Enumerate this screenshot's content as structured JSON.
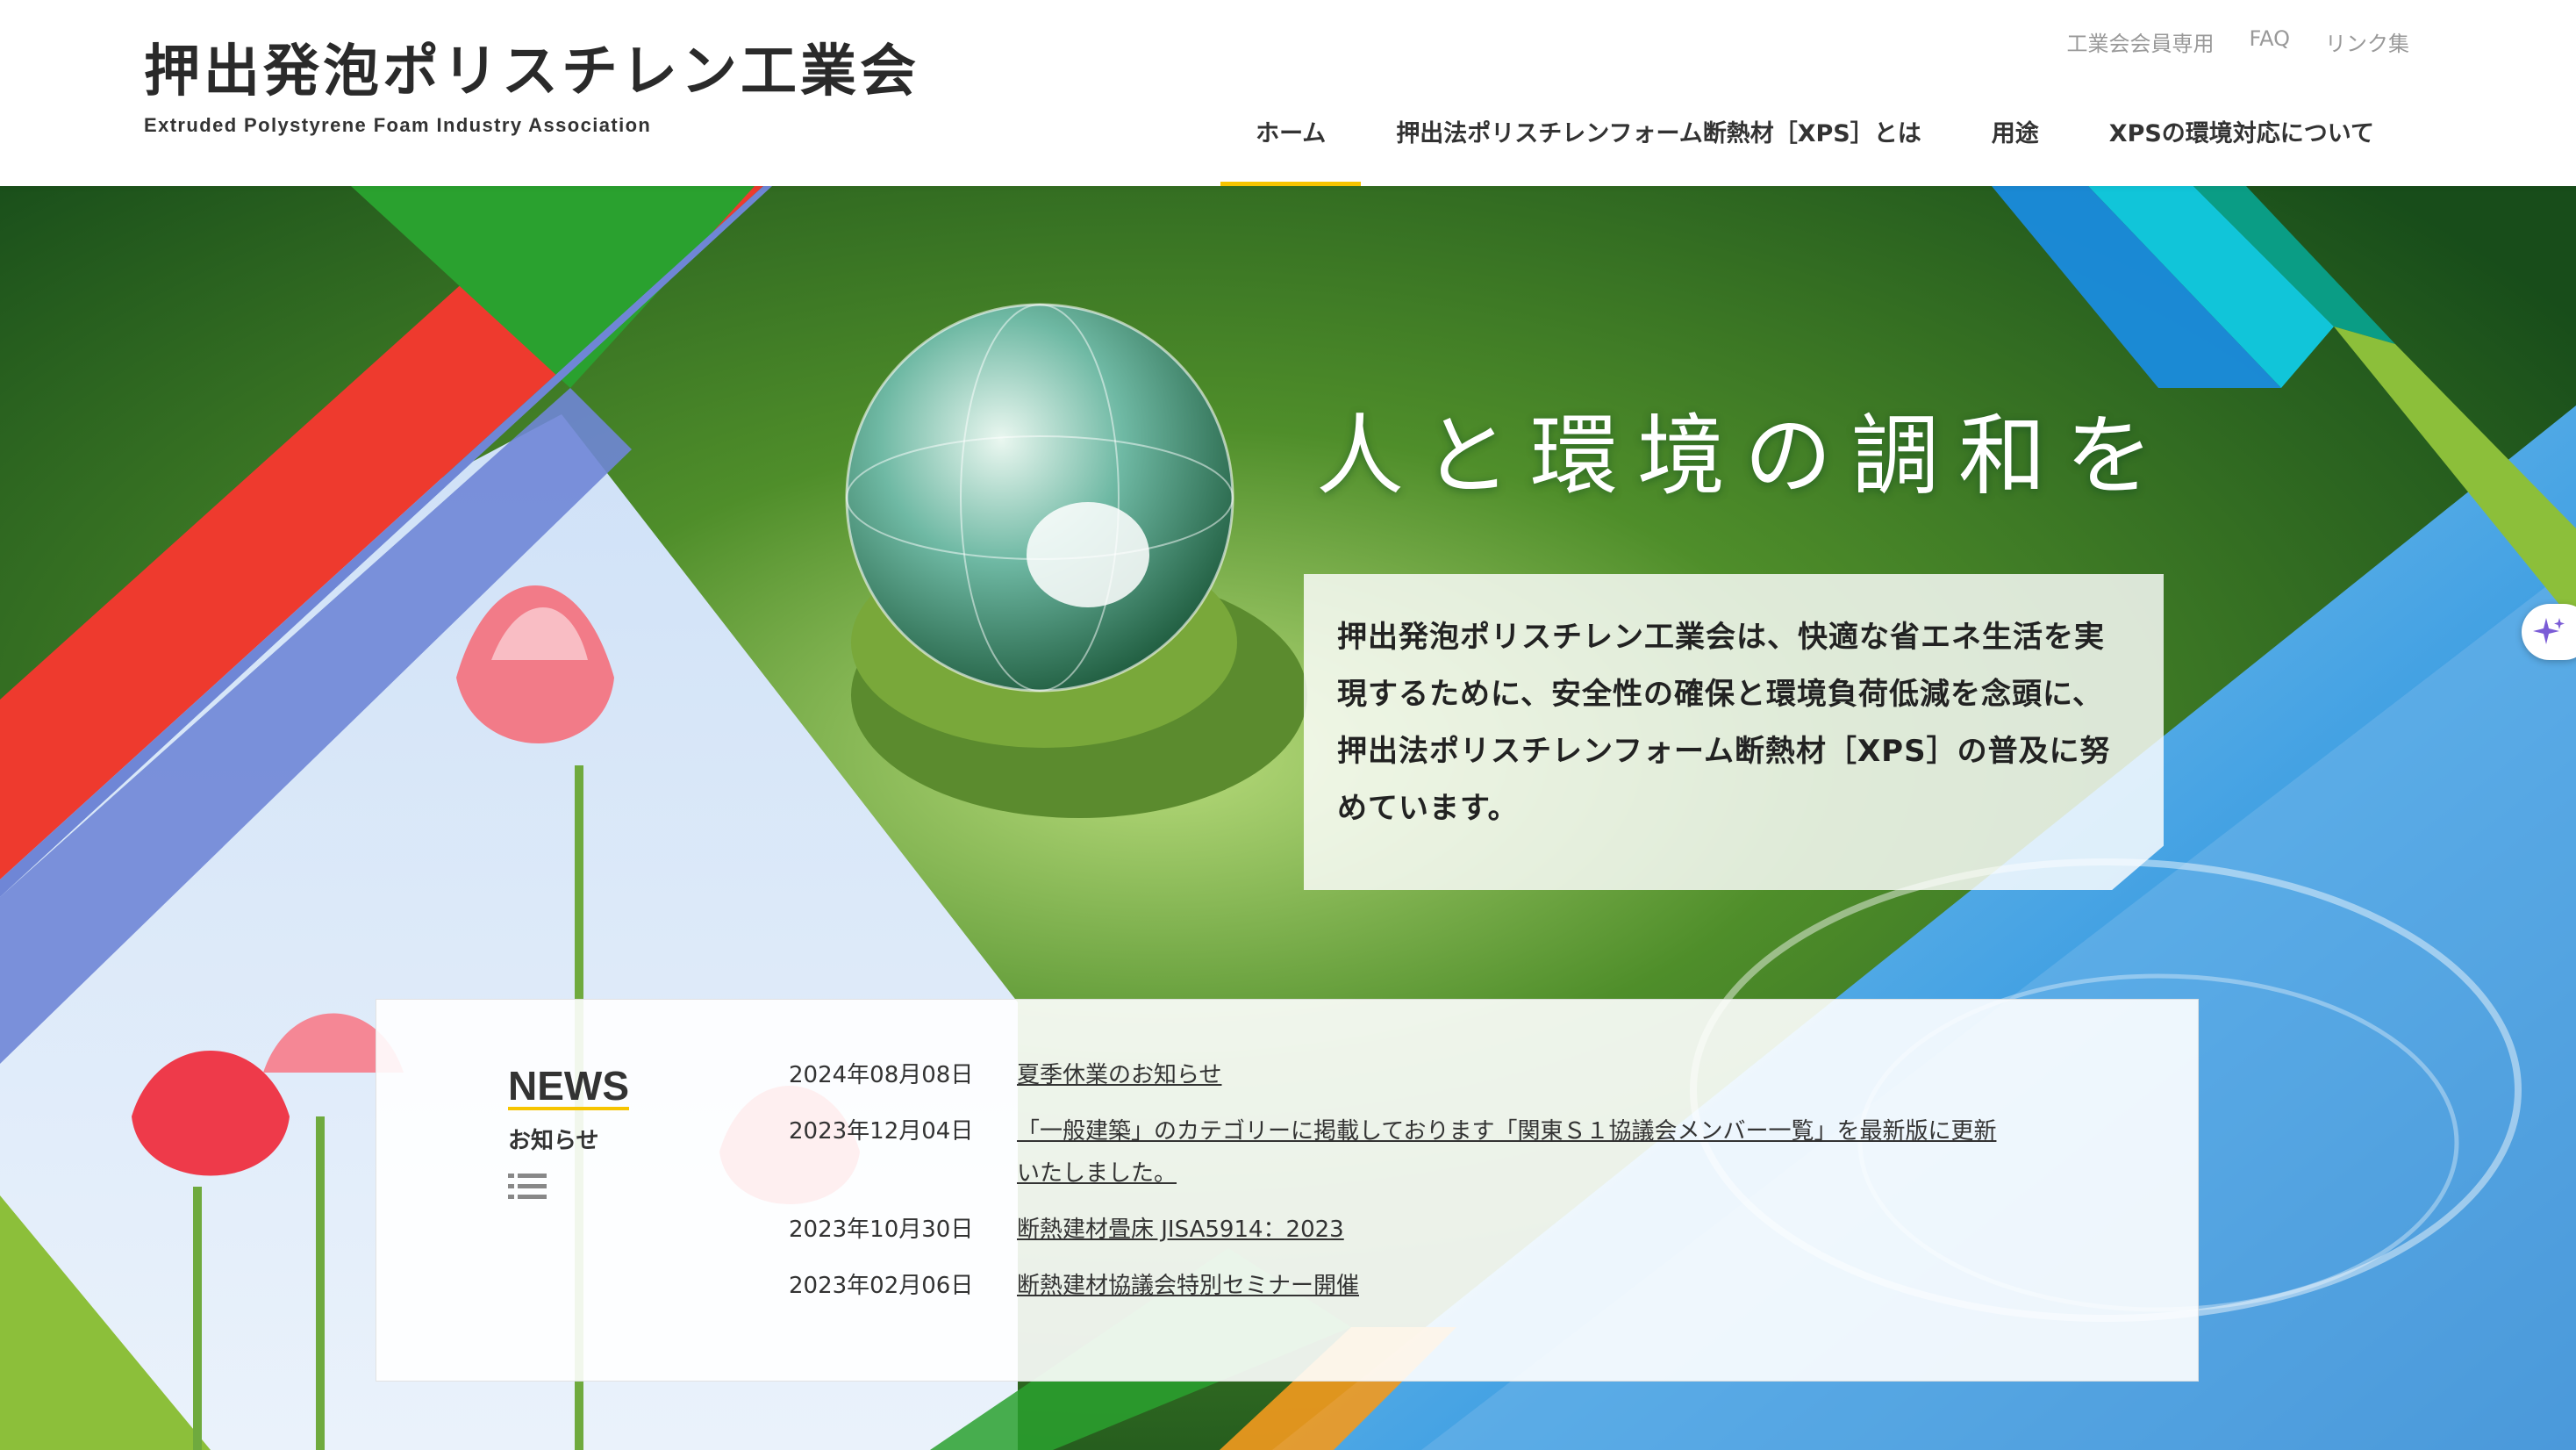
{
  "header": {
    "logo_jp": "押出発泡ポリスチレン工業会",
    "logo_en": "Extruded Polystyrene Foam Industry Association",
    "util_nav": [
      "工業会会員専用",
      "FAQ",
      "リンク集"
    ],
    "main_nav": [
      {
        "label": "ホーム",
        "active": true
      },
      {
        "label": "押出法ポリスチレンフォーム断熱材［XPS］とは",
        "active": false
      },
      {
        "label": "用途",
        "active": false
      },
      {
        "label": "XPSの環境対応について",
        "active": false
      }
    ]
  },
  "hero": {
    "heading": "人と環境の調和を",
    "text": "押出発泡ポリスチレン工業会は、快適な省エネ生活を実現するために、安全性の確保と環境負荷低減を念頭に、押出法ポリスチレンフォーム断熱材［XPS］の普及に努めています。"
  },
  "news": {
    "title_en": "NEWS",
    "title_jp": "お知らせ",
    "items": [
      {
        "date": "2024年08月08日",
        "title": "夏季休業のお知らせ"
      },
      {
        "date": "2023年12月04日",
        "title": "「一般建築」のカテゴリーに掲載しております「関東Ｓ１協議会メンバー一覧」を最新版に更新いたしました。"
      },
      {
        "date": "2023年10月30日",
        "title": "断熱建材畳床 JISA5914：2023"
      },
      {
        "date": "2023年02月06日",
        "title": "断熱建材協議会特別セミナー開催"
      }
    ]
  },
  "colors": {
    "accent": "#f6c400",
    "red": "#ee3a2e",
    "green": "#2aa12f",
    "blue": "#1a8ee8",
    "lime": "#8cbf3a"
  }
}
